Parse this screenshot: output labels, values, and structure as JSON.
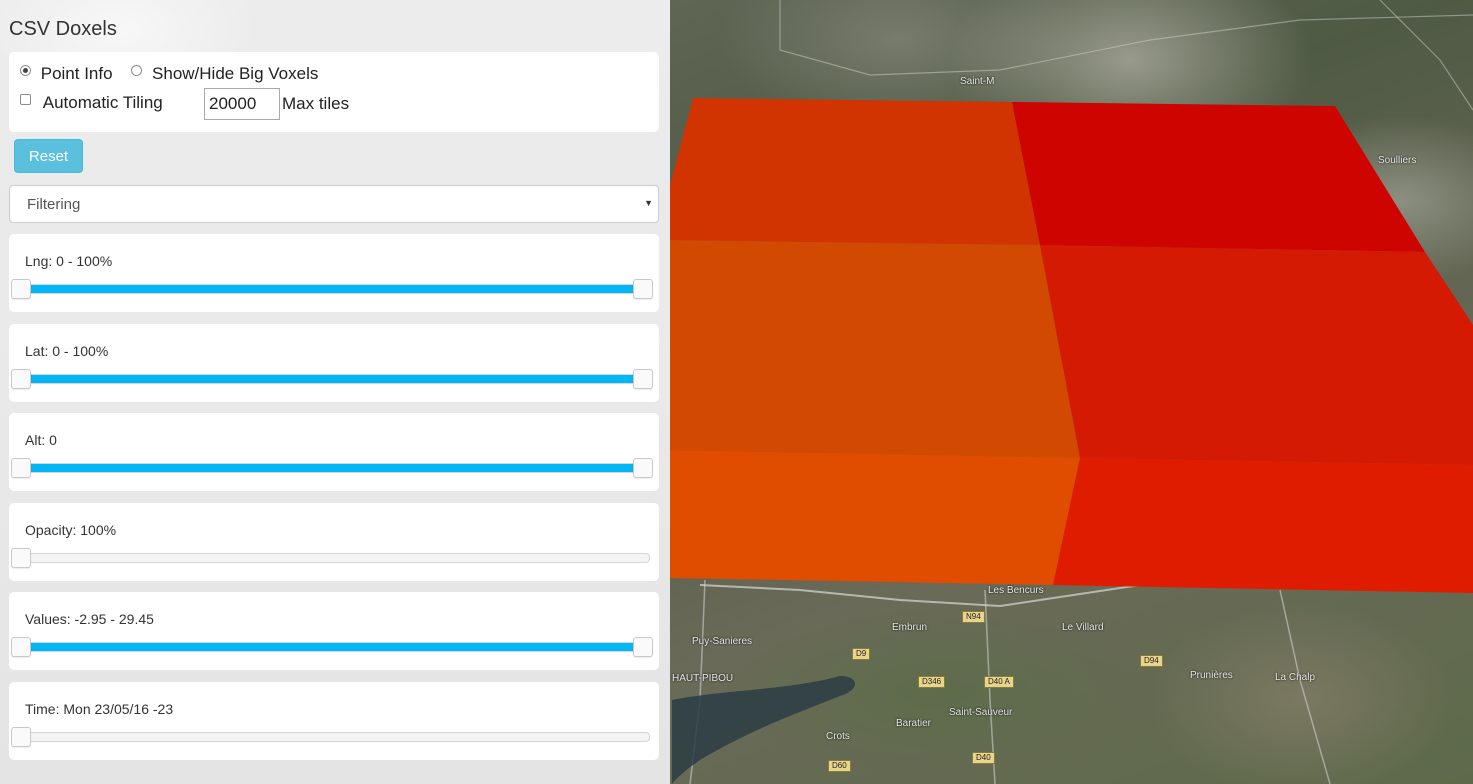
{
  "panel": {
    "title": "CSV Doxels",
    "mode_options": [
      {
        "label": "Point Info",
        "checked": true
      },
      {
        "label": "Show/Hide Big Voxels",
        "checked": false
      }
    ],
    "automatic_tiling": {
      "label": "Automatic Tiling",
      "checked": false
    },
    "max_tiles": {
      "value": "20000",
      "label": "Max tiles"
    },
    "reset_label": "Reset",
    "filter_select": {
      "selected": "Filtering"
    },
    "sliders": [
      {
        "id": "lng",
        "label": "Lng: 0 - 100%",
        "range": true,
        "low": 0,
        "high": 1
      },
      {
        "id": "lat",
        "label": "Lat: 0 - 100%",
        "range": true,
        "low": 0,
        "high": 1
      },
      {
        "id": "alt",
        "label": "Alt: 0",
        "range": true,
        "low": 0,
        "high": 1
      },
      {
        "id": "opacity",
        "label": "Opacity: 100%",
        "range": false,
        "low": 0,
        "high": 0
      },
      {
        "id": "values",
        "label": "Values: -2.95 - 29.45",
        "range": true,
        "low": 0,
        "high": 1
      },
      {
        "id": "time",
        "label": "Time: Mon 23/05/16 -23",
        "range": false,
        "low": 0,
        "high": 0
      }
    ],
    "accent_color": "#00b6f7",
    "button_color": "#5bc0de"
  },
  "map": {
    "place_labels": [
      "Saint-M",
      "Soulliers",
      "Les Bencurs",
      "Embrun",
      "Le Villard",
      "Puy-Sanieres",
      "Baratier",
      "Saint-Sauveur",
      "Crots",
      "Prunières",
      "La Chalp",
      "HAUT-PIBOU"
    ],
    "road_badges": [
      "D9",
      "D346",
      "D40 A",
      "D40",
      "D60",
      "D94",
      "N94"
    ],
    "voxel_colors": [
      "#d13400",
      "#cd0400",
      "#d24a02",
      "#d41a02",
      "#e04c00",
      "#e01c00"
    ]
  }
}
